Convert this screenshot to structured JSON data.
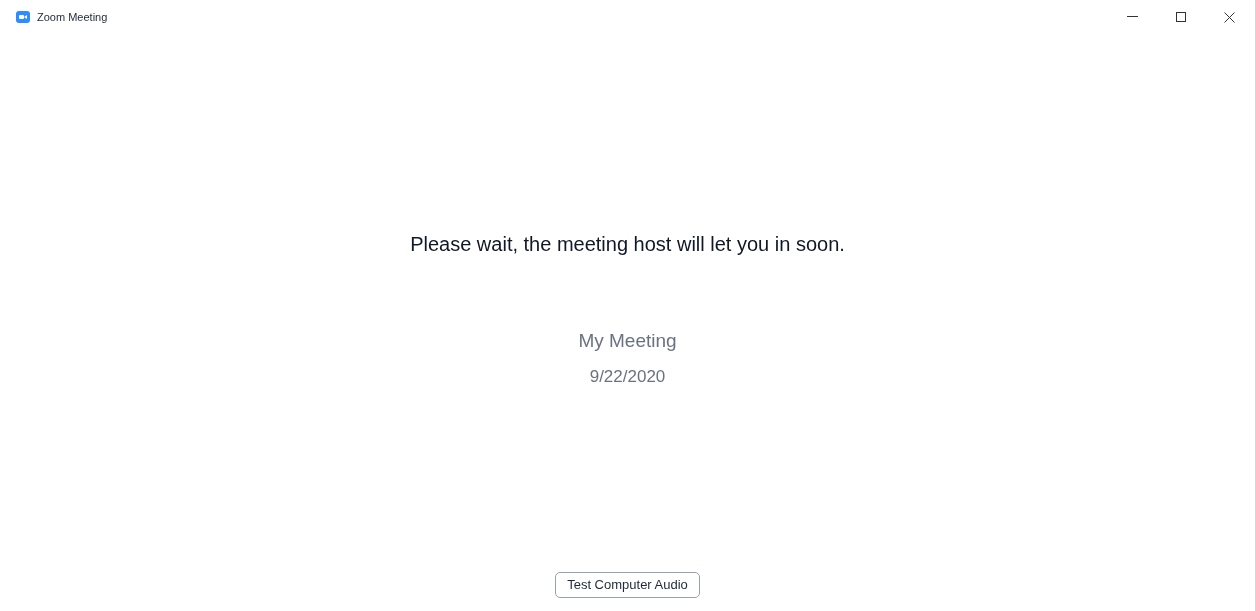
{
  "window": {
    "title": "Zoom Meeting"
  },
  "message": "Please wait, the meeting host will let you in soon.",
  "meeting": {
    "topic": "My Meeting",
    "date": "9/22/2020"
  },
  "buttons": [
    "Test Computer Audio"
  ]
}
